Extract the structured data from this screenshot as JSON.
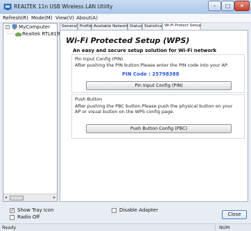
{
  "window": {
    "title": "REALTEK 11n USB Wireless LAN Utility",
    "controls": {
      "minimize": "‒",
      "maximize": "□",
      "close": "✕"
    }
  },
  "menu": {
    "items": [
      "Refresh(R)",
      "Mode(M)",
      "View(V)",
      "About(A)"
    ]
  },
  "tree": {
    "root_expander": "-",
    "root_label": "MyComputer",
    "child_label": "Realtek RTL819",
    "scroll_left": "◂",
    "scroll_right": "▸"
  },
  "tabs": [
    {
      "label": "General"
    },
    {
      "label": "Profile"
    },
    {
      "label": "Available Network"
    },
    {
      "label": "Status"
    },
    {
      "label": "Statistics"
    },
    {
      "label": "Wi-Fi Protect Setup",
      "active": true
    }
  ],
  "wps": {
    "title": "Wi-Fi Protected Setup (WPS)",
    "subtitle": "An easy and secure setup solution for Wi-Fi network",
    "pin": {
      "group_title": "Pin Input Config (PIN)",
      "description": "After pushing the PIN button.Please enter the PIN code into your AP.",
      "pin_code_text": "PIN Code : 25798388",
      "button_label": "Pin Input Config (PIN)"
    },
    "pbc": {
      "group_title": "Push Button",
      "description_line1": "After pushing the PBC button.Please push the physical button on your",
      "description_line2": "AP or visual button on the WPS config page.",
      "button_label": "Push Button Config (PBC)"
    }
  },
  "bottom": {
    "show_tray_icon": {
      "label": "Show Tray Icon",
      "checked": true
    },
    "radio_off": {
      "label": "Radio Off",
      "checked": false
    },
    "disable_adapter": {
      "label": "Disable Adapter",
      "checked": false
    },
    "close_label": "Close"
  },
  "status": {
    "left": "Ready",
    "right": "NUM"
  }
}
